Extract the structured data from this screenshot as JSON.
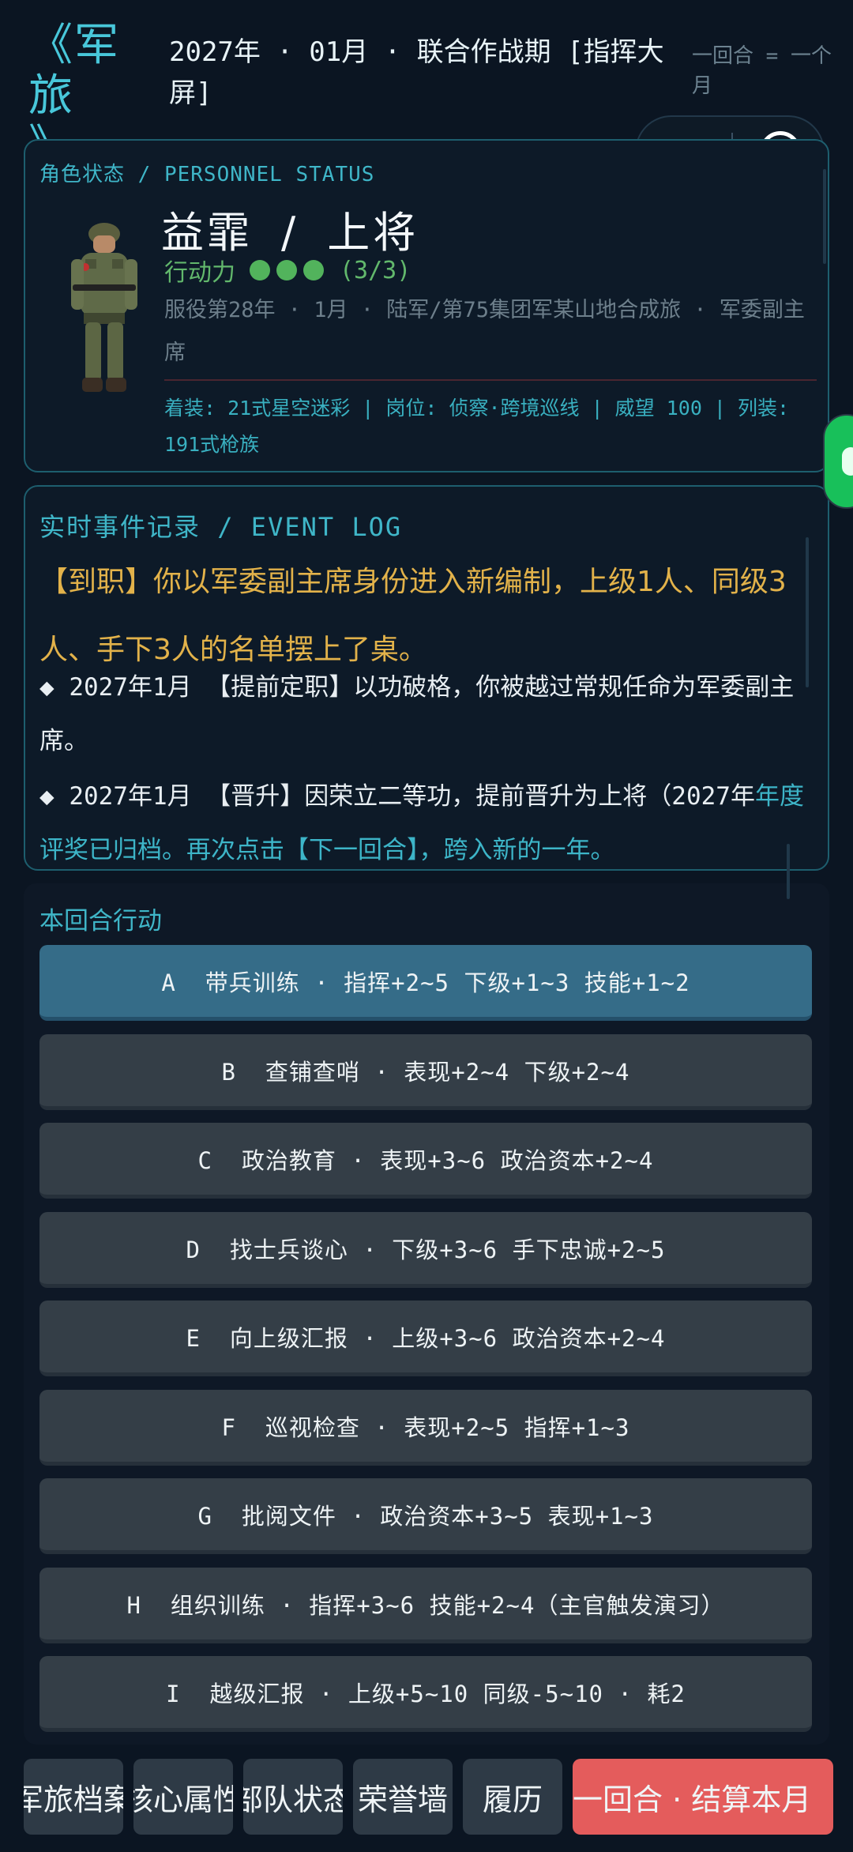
{
  "header": {
    "logo_title": "《军旅",
    "logo_close": "》",
    "date_line": "2027年 · 01月 · 联合作战期 [指挥大屏]",
    "turn_note": "一回合 = 一个月"
  },
  "status": {
    "section_title": "角色状态 / PERSONNEL STATUS",
    "name": "益霏",
    "rank": "上将",
    "name_separator": "/",
    "ap_label": "行动力",
    "ap_value": 3,
    "ap_max": 3,
    "ap_text": "(3/3)",
    "service": "服役第28年 · 1月 · 陆军/第75集团军某山地合成旅 · 军委副主席",
    "equipment": "着装: 21式星空迷彩 | 岗位: 侦察·跨境巡线 | 威望 100 | 列装: 191式枪族"
  },
  "event_log": {
    "section_title": "实时事件记录 / EVENT LOG",
    "highlight": "【到职】你以军委副主席身份进入新编制，上级1人、同级3人、手下3人的名单摆上了桌。",
    "entry1": "◆ 2027年1月 【提前定职】以功破格，你被越过常规任命为军委副主席。",
    "entry2_main": "◆ 2027年1月 【晋升】因荣立二等功，提前晋升为上将（2027年",
    "entry2_accent": "年度评奖已归档。再次点击【下一回合】，跨入新的一年。"
  },
  "actions": {
    "section_title": "本回合行动",
    "items": [
      {
        "label": "A  带兵训练 · 指挥+2~5 下级+1~3 技能+1~2",
        "active": true
      },
      {
        "label": "B  查铺查哨 · 表现+2~4 下级+2~4",
        "active": false
      },
      {
        "label": "C  政治教育 · 表现+3~6 政治资本+2~4",
        "active": false
      },
      {
        "label": "D  找士兵谈心 · 下级+3~6 手下忠诚+2~5",
        "active": false
      },
      {
        "label": "E  向上级汇报 · 上级+3~6 政治资本+2~4",
        "active": false
      },
      {
        "label": "F  巡视检查 · 表现+2~5 指挥+1~3",
        "active": false
      },
      {
        "label": "G  批阅文件 · 政治资本+3~5 表现+1~3",
        "active": false
      },
      {
        "label": "H  组织训练 · 指挥+3~6 技能+2~4（主官触发演习）",
        "active": false
      },
      {
        "label": "I  越级汇报 · 上级+5~10 同级-5~10 · 耗2",
        "active": false
      }
    ]
  },
  "nav": {
    "profile": "军旅档案",
    "attributes": "核心属性",
    "troops": "部队状态",
    "honors": "荣誉墙",
    "resume": "履历",
    "next_turn": "下一回合 · 结算本月"
  },
  "colors": {
    "accent": "#3fb6c8",
    "highlight": "#e2b24a",
    "active_action": "#356c88",
    "next_turn": "#e45c5c",
    "ap_dot": "#52b35c"
  }
}
